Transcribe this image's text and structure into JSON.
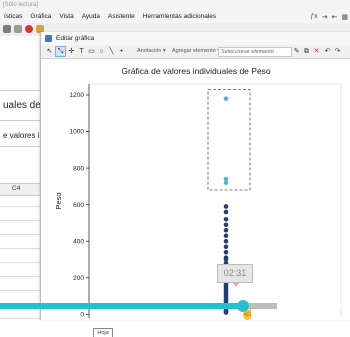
{
  "window_title": "[Sólo lectura]",
  "menu": [
    "Estadísticas",
    "Gráfica",
    "Vista",
    "Ayuda",
    "Asistente",
    "Herramientas adicionales"
  ],
  "menu_visible": [
    "ísticas",
    "Gráfica",
    "Vista",
    "Ayuda",
    "Asistente",
    "Herramientas adicionales"
  ],
  "menu_right_icons": [
    "fx-icon",
    "row-insert-icon",
    "col-insert-icon",
    "grid-icon"
  ],
  "background": {
    "title_fragment": "uales de P",
    "subtitle_fragment": "e valores indi",
    "column_header": "C4"
  },
  "dialog": {
    "title": "Editar gráfica",
    "annotation_label": "Anotación",
    "add_element_label": "Agregar elemento",
    "select_element_placeholder": "Seleccionar elemento"
  },
  "chart_data": {
    "type": "scatter",
    "title": "Gráfica de valores individuales de Peso",
    "ylabel": "Peso",
    "xlabel": "",
    "ylim": [
      -20,
      1260
    ],
    "yticks": [
      0,
      200,
      400,
      600,
      800,
      1000,
      1200
    ],
    "series": [
      {
        "name": "",
        "color": "#1f3f75",
        "values": [
          590,
          560,
          520,
          490,
          460,
          430,
          400,
          370,
          340,
          310,
          300,
          280,
          260,
          240,
          230,
          220,
          210,
          200,
          190,
          180,
          170,
          160,
          150,
          140,
          130,
          120,
          110,
          100,
          90,
          80,
          70,
          60,
          50,
          40,
          30,
          20,
          15,
          10
        ]
      },
      {
        "name": "",
        "color": "#4fb8c8",
        "values": [
          1180,
          740,
          720
        ]
      }
    ],
    "highlight_box": {
      "y_range": [
        680,
        1230
      ],
      "style": "dashed"
    }
  },
  "video": {
    "time": "02:31",
    "progress": 0.695,
    "buffered": 0.79
  },
  "bottom_tab": "Hoja"
}
